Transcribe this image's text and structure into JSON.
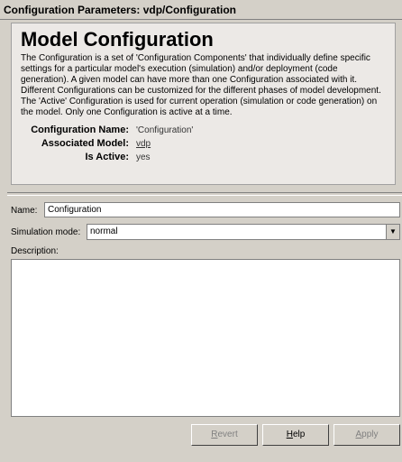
{
  "window": {
    "title": "Configuration Parameters: vdp/Configuration"
  },
  "info": {
    "heading": "Model Configuration",
    "description": "The Configuration is a set of 'Configuration Components' that individually define specific settings for a particular model's execution (simulation) and/or deployment (code generation). A given model can have more than one Configuration associated with it. Different Configurations can be customized for the different phases of model development. The 'Active' Configuration is used for current operation (simulation or code generation) on the model. Only one Configuration is active at a time.",
    "config_name_key": "Configuration Name:",
    "config_name_val": "'Configuration'",
    "assoc_model_key": "Associated Model:",
    "assoc_model_val": "vdp",
    "is_active_key": "Is Active:",
    "is_active_val": "yes"
  },
  "form": {
    "name_label": "Name:",
    "name_value": "Configuration",
    "sim_mode_label": "Simulation mode:",
    "sim_mode_value": "normal",
    "description_label": "Description:",
    "description_value": ""
  },
  "buttons": {
    "revert_first": "R",
    "revert_rest": "evert",
    "help_first": "H",
    "help_rest": "elp",
    "apply_first": "A",
    "apply_rest": "pply"
  }
}
